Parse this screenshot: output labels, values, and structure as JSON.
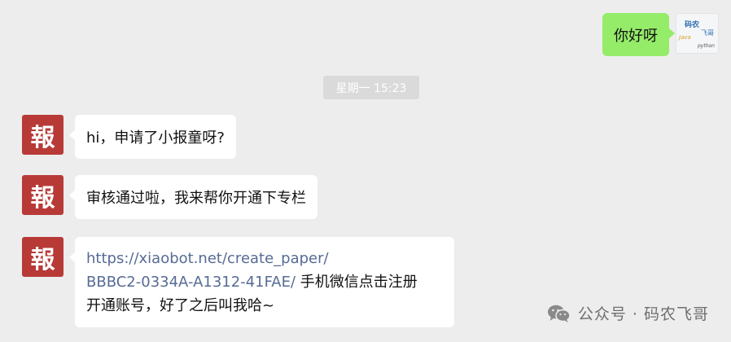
{
  "self_message": {
    "text": "你好呀",
    "avatar": {
      "line1": "码农",
      "line2": "飞哥",
      "line3": "Java",
      "line4": "python"
    }
  },
  "timestamp": "星期一 15:23",
  "bot_avatar_text": "報",
  "bot_messages": [
    {
      "text": "hi，申请了小报童呀?"
    },
    {
      "text": "审核通过啦，我来帮你开通下专栏"
    },
    {
      "link_line1": "https://xiaobot.net/create_paper/",
      "link_line2": "BBBC2-0334A-A1312-41FAE/",
      "tail_line2": " 手机微信点击注册",
      "line3": "开通账号，好了之后叫我哈~"
    }
  ],
  "watermark": {
    "icon": "wechat-icon",
    "text": "公众号 · 码农飞哥"
  },
  "colors": {
    "background": "#ededed",
    "self_bubble": "#95ec69",
    "bot_bubble": "#ffffff",
    "bot_avatar": "#b83a37",
    "link": "#576b95"
  }
}
